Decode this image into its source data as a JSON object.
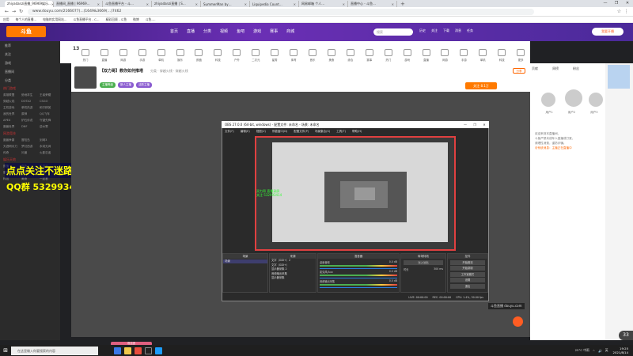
{
  "browser": {
    "tabs": [
      {
        "label": "zhiyadanzi直播_96969娱乐…",
        "active": true
      },
      {
        "label": "直播间_直播 | 96969…",
        "active": false
      },
      {
        "label": "斗鱼直播平台 - 斗…",
        "active": false
      },
      {
        "label": "zhiyadanzi直播 | S…",
        "active": false
      },
      {
        "label": "SummerMan by…",
        "active": false
      },
      {
        "label": "Liquipedia Count…",
        "active": false
      },
      {
        "label": "网易邮箱 个人…",
        "active": false
      },
      {
        "label": "直播中心 - 斗鱼…",
        "active": false
      }
    ],
    "new_tab": "+",
    "window_controls": [
      "—",
      "❐",
      "✕"
    ],
    "url": "www.douyu.com/2166077(...)1649&3669(…)7462",
    "bookmarks": [
      "应用",
      "每个人的直播…",
      "电脑的实用网站…",
      "斗鱼直播平台 - C…",
      "精彩回顾 - 斗鱼",
      "微博",
      "斗鱼-…"
    ]
  },
  "site": {
    "logo": "斗鱼",
    "topnav": [
      "首页",
      "直播",
      "分类",
      "视频",
      "鱼吧",
      "游戏",
      "赛事",
      "商城"
    ],
    "search_placeholder": "搜索",
    "header_icons": [
      "历史",
      "关注",
      "下载",
      "消息",
      "任务"
    ],
    "broadcast_button": "我要开播",
    "level": "13"
  },
  "sidebar": {
    "items": [
      "推荐",
      "关注",
      "游戏",
      "直播间",
      "分类"
    ],
    "sections": [
      {
        "head": "热门游戏",
        "cats": [
          "英雄联盟",
          "绝地求生",
          "王者荣耀",
          "穿越火线",
          "DOTA2",
          "CSGO",
          "主机游戏",
          "单机热游",
          "和平精英",
          "我的世界",
          "原神",
          "QQ飞车",
          "APEX",
          "炉石传说",
          "守望先锋",
          "魔兽世界",
          "DNF",
          "逆水寒"
        ]
      },
      {
        "head": "网游竞技",
        "cats": [
          "魔兽争霸",
          "冒险岛",
          "剑网3",
          "天涯明月刀",
          "梦幻西游",
          "永劫无间",
          "传奇",
          "问道",
          "火影忍者"
        ]
      },
      {
        "head": "娱乐天地",
        "cats": [
          "颜值",
          "户外",
          "二次元",
          "星秀",
          "音乐",
          "舞蹈",
          "科技",
          "美食",
          "一起看"
        ]
      }
    ],
    "overlay_follow": "点点关注不迷路",
    "overlay_qq": "QQ群 532993414"
  },
  "categories": [
    "热门",
    "直播",
    "网游",
    "手游",
    "单机",
    "娱乐",
    "颜值",
    "科技",
    "户外",
    "二次元",
    "星秀",
    "体育",
    "音乐",
    "美食",
    "综合",
    "赛事",
    "热门",
    "游戏",
    "直播",
    "网游",
    "手游",
    "单机",
    "科技",
    "更多"
  ],
  "room": {
    "title": "【双力哥】教你如何推塔",
    "category": "分类 · 穿越火线 · 穿越火线",
    "tags": [
      "主播等级",
      "新人主播",
      "活跃主播"
    ],
    "follow_button": "关注 8.1万",
    "share_button": "分享"
  },
  "video": {
    "watermark": "斗鱼直播 douyu.com",
    "bottom_badge": "粉丝团"
  },
  "obs": {
    "title": "OBS 27.0.0 (64-bit, windows) - 配置文件: 未命名 - 场景: 未命名",
    "window_controls": [
      "—",
      "❐",
      "✕"
    ],
    "menu": [
      "文件(F)",
      "编辑(E)",
      "视图(V)",
      "停靠窗口(D)",
      "配置文件(P)",
      "场景集合(S)",
      "工具(T)",
      "帮助(H)"
    ],
    "preview_label": "双力哥 直播录屏\n关注 532993414",
    "docks": {
      "scenes": {
        "title": "场景",
        "items": [
          "场景"
        ]
      },
      "sources": {
        "title": "来源",
        "items": [
          "文字（GDI+）2",
          "文字（GDI+）",
          "显示器采集 2",
          "音频输出采集",
          "显示器采集"
        ]
      },
      "mixer": {
        "title": "混音器",
        "tracks": [
          {
            "name": "桌面音频",
            "level": "0.0 dB"
          },
          {
            "name": "麦克风/Aux",
            "level": "0.0 dB"
          },
          {
            "name": "音频输出采集",
            "level": "0.0 dB"
          }
        ]
      },
      "transitions": {
        "title": "转场特效",
        "fade": "淡入淡出",
        "duration_label": "时长",
        "duration_value": "300 ms"
      },
      "controls": {
        "title": "控件",
        "buttons": [
          "开始推流",
          "开始录制",
          "工作室模式",
          "设置",
          "退出"
        ]
      }
    },
    "status": [
      "LIVE: 00:00:00",
      "REC: 00:00:00",
      "CPU: 1.4%, 30.00 fps"
    ]
  },
  "rightpanel": {
    "tabs": [
      "贡献",
      "周榜",
      "粉丝"
    ],
    "fans": [
      "用户1",
      "用户2",
      "用户3"
    ],
    "notice_lines": [
      "欢迎来到本直播间，",
      "斗鱼严禁未成年人直播或打赏，",
      "请理性消费，谨防诈骗。",
      "@系统消息：主播正在直播中"
    ],
    "counter": "33"
  },
  "taskbar": {
    "search_placeholder": "在这里输入你要搜索的内容",
    "tray": [
      "25°C 中雨",
      "^",
      "🔊",
      "英"
    ],
    "time": "19:25",
    "date": "2021/8/14"
  },
  "colors": {
    "accent": "#ff7a00",
    "header_purple": "#6b2fb5",
    "obs_red_border": "#e04040",
    "overlay_yellow": "#ffff00"
  }
}
